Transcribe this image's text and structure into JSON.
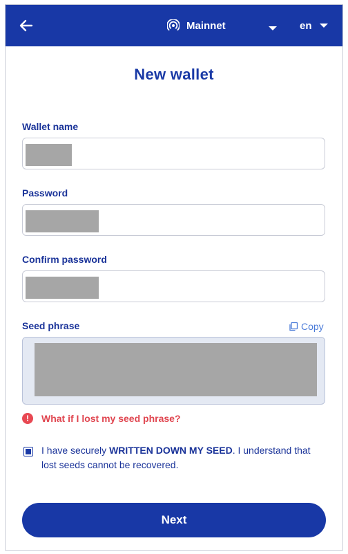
{
  "header": {
    "back_icon": "arrow-left-icon",
    "network_icon": "signal-icon",
    "network_label": "Mainnet",
    "language_label": "en"
  },
  "title": "New wallet",
  "form": {
    "wallet_name_label": "Wallet name",
    "password_label": "Password",
    "confirm_password_label": "Confirm password",
    "seed_phrase_label": "Seed phrase",
    "copy_label": "Copy"
  },
  "warning_link": "What if I lost my seed phrase?",
  "agreement": {
    "checked": true,
    "text_before": "I have securely ",
    "text_bold": "WRITTEN DOWN MY SEED",
    "text_after": ". I understand that lost seeds cannot be recovered."
  },
  "next_label": "Next",
  "colors": {
    "primary": "#1838a6",
    "link": "#4a7bd8",
    "warning": "#e0454f",
    "seed_bg": "#e4e9f3"
  }
}
